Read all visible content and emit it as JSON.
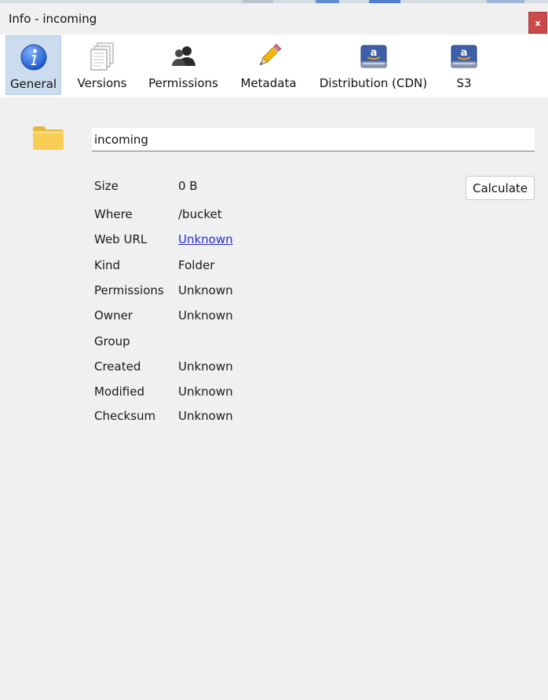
{
  "window": {
    "title": "Info - incoming",
    "close_label": "x"
  },
  "toolbar": {
    "tabs": [
      {
        "label": "General",
        "icon": "info-icon",
        "active": true
      },
      {
        "label": "Versions",
        "icon": "versions-icon",
        "active": false
      },
      {
        "label": "Permissions",
        "icon": "users-icon",
        "active": false
      },
      {
        "label": "Metadata",
        "icon": "pencil-icon",
        "active": false
      },
      {
        "label": "Distribution (CDN)",
        "icon": "amazon-drive-icon",
        "active": false
      },
      {
        "label": "S3",
        "icon": "amazon-drive-icon",
        "active": false
      }
    ]
  },
  "general": {
    "filename": "incoming",
    "calculate_label": "Calculate",
    "rows": [
      {
        "key": "Size",
        "value": "0 B"
      },
      {
        "key": "Where",
        "value": "/bucket"
      },
      {
        "key": "Web URL",
        "value": "Unknown",
        "is_link": true
      },
      {
        "key": "Kind",
        "value": "Folder"
      },
      {
        "key": "Permissions",
        "value": "Unknown"
      },
      {
        "key": "Owner",
        "value": "Unknown"
      },
      {
        "key": "Group",
        "value": ""
      },
      {
        "key": "Created",
        "value": "Unknown"
      },
      {
        "key": "Modified",
        "value": "Unknown"
      },
      {
        "key": "Checksum",
        "value": "Unknown"
      }
    ]
  },
  "colors": {
    "active_tab_bg": "#cbdcef",
    "close_button": "#c94a49",
    "link": "#2b2bd8",
    "folder": "#f7cd55"
  }
}
